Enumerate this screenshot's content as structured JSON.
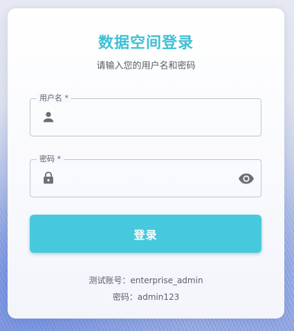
{
  "login": {
    "title": "数据空间登录",
    "subtitle": "请输入您的用户名和密码",
    "username": {
      "label": "用户名 *",
      "value": "",
      "icon": "person-icon"
    },
    "password": {
      "label": "密码 *",
      "value": "",
      "icon": "lock-icon",
      "toggle_icon": "eye-icon"
    },
    "submit_label": "登录",
    "test_account": "测试账号：enterprise_admin",
    "test_password": "密码：admin123"
  },
  "colors": {
    "accent": "#47c9dd",
    "title": "#3fbfd4",
    "icon": "#6b6f75"
  }
}
